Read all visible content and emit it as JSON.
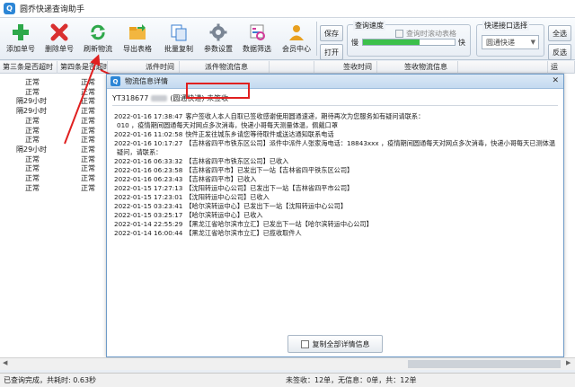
{
  "window": {
    "title": "圆乔快递查询助手",
    "icon_text": "Q"
  },
  "toolbar": {
    "buttons": [
      {
        "label": "添加单号",
        "icon": "plus-icon",
        "color": "#2ea84a"
      },
      {
        "label": "删除单号",
        "icon": "delete-x-icon",
        "color": "#d93030"
      },
      {
        "label": "刷新物流",
        "icon": "refresh-icon",
        "color": "#2ea84a"
      },
      {
        "label": "导出表格",
        "icon": "export-folder-icon",
        "color": "#e8a020"
      },
      {
        "label": "批量复制",
        "icon": "copy-icon",
        "color": "#3b7fd0"
      },
      {
        "label": "参数设置",
        "icon": "gear-icon",
        "color": "#7a8594"
      },
      {
        "label": "数据筛选",
        "icon": "filter-icon",
        "color": "#d23a9a"
      },
      {
        "label": "会员中心",
        "icon": "member-icon",
        "color": "#e8a020"
      }
    ],
    "save_label": "保存",
    "open_label": "打开",
    "speed_group_title": "查询速度",
    "speed_slow": "慢",
    "speed_fast": "快",
    "speed_level": 0.62,
    "scroll_checkbox_label": "查询时滚动表格",
    "api_group_title": "快递接口选择",
    "api_selected": "圆通快递",
    "select_all_label": "全选",
    "invert_label": "反选"
  },
  "table": {
    "headers": [
      "第三条是否超时",
      "第四条是否超时",
      "派件时间",
      "派件物流信息",
      "",
      "签收时间",
      "签收物流信息",
      "",
      "运"
    ],
    "col3": [
      "正常",
      "正常",
      "隔29小时",
      "隔29小时",
      "正常",
      "正常",
      "正常",
      "隔29小时",
      "正常",
      "正常",
      "正常",
      "正常"
    ],
    "col4": [
      "正常",
      "正常",
      "正常",
      "正常",
      "正常",
      "正常",
      "正常",
      "正常",
      "正常",
      "正常",
      "正常",
      "正常"
    ]
  },
  "dialog": {
    "title": "物流信息详情",
    "close_label": "✕",
    "tracking_prefix": "YT318677",
    "tracking_status": "(圆通快递) 未签收",
    "log": [
      {
        "t": "2022-01-16 17:38:47",
        "text": "客户签收人本人自取已签收感谢使用圆通速递，期待再次为您服务如有疑问请联系："
      },
      {
        "t": "",
        "text": "010 ，疫情期间圆通每天对网点多次消毒，快递小哥每天测量体温，佩戴口罩"
      },
      {
        "t": "2022-01-16 11:02:58",
        "text": "快件正发往城东乡请您等待取件或送达通知联系电话"
      },
      {
        "t": "2022-01-16 10:17:27",
        "text": "【吉林省四平市铁东区公司】派件中派件人张家海电话：18843xxx ，疫情期间圆通每天对网点多次消毒，快递小哥每天已测体温，请放心收寄快递如有"
      },
      {
        "t": "",
        "text": "疑问，请联系："
      },
      {
        "t": "2022-01-16 06:33:32",
        "text": "【吉林省四平市铁东区公司】已收入"
      },
      {
        "t": "2022-01-16 06:23:58",
        "text": "【吉林省四平市】已发出下一站【吉林省四平铁东区公司】"
      },
      {
        "t": "2022-01-16 06:23:43",
        "text": "【吉林省四平市】已收入"
      },
      {
        "t": "2022-01-15 17:27:13",
        "text": "【沈阳转运中心公司】已发出下一站【吉林省四平市公司】"
      },
      {
        "t": "2022-01-15 17:23:01",
        "text": "【沈阳转运中心公司】已收入"
      },
      {
        "t": "2022-01-15 03:23:41",
        "text": "【哈尔滨转运中心】已发出下一站【沈阳转运中心公司】"
      },
      {
        "t": "2022-01-15 03:25:17",
        "text": "【哈尔滨转运中心】已收入"
      },
      {
        "t": "2022-01-14 22:55:29",
        "text": "【黑龙江省哈尔滨市立汇】已发出下一站【哈尔滨转运中心公司】"
      },
      {
        "t": "2022-01-14 16:00:44",
        "text": "【黑龙江省哈尔滨市立汇】已揽收取件人"
      }
    ],
    "copy_button_label": "复制全部详情信息"
  },
  "status": {
    "left": "已查询完成，共耗时: 0.63秒",
    "right": "未签收：12单，无信息：0单，共：12单"
  }
}
